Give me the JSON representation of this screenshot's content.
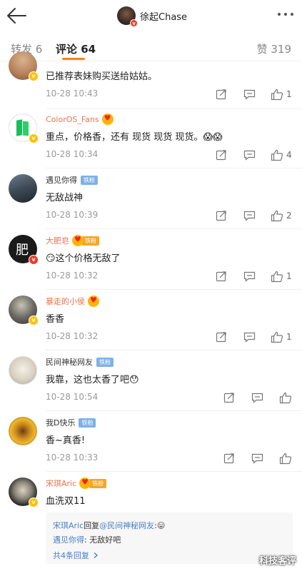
{
  "header": {
    "title": "徐起Chase",
    "back_icon": "back-arrow-icon",
    "more_icon": "more-dots-icon"
  },
  "tabs": {
    "repost": "转发 6",
    "comments": "评论 64",
    "likes": "赞 319",
    "accent": "#ff8200"
  },
  "comments": [
    {
      "user": "",
      "text": "已推荐表妹购买送给姑姑。",
      "time": "10-28 10:43",
      "likes": "1"
    },
    {
      "user": "ColorOS_Fans",
      "text": "重点，价格香，还有 现货 现货 现货。😱😱",
      "time": "10-28 10:34",
      "likes": "4"
    },
    {
      "user": "遇见你得",
      "badge": "铁粉",
      "text": "无敌战神",
      "time": "10-28 10:39",
      "likes": "2"
    },
    {
      "user": "大肥皂",
      "badge": "铁粉",
      "text": "😏这个价格无敌了",
      "time": "10-28 10:32",
      "likes": "1"
    },
    {
      "user": "暴走的小侯",
      "text": "香香",
      "time": "10-28 10:32",
      "likes": "1"
    },
    {
      "user": "民间神秘网友",
      "badge": "铁粉",
      "text": "我靠，这也太香了吧😯",
      "time": "10-28 10:54",
      "likes": ""
    },
    {
      "user": "我D快乐",
      "badge": "铁粉",
      "text": "香~真香!",
      "time": "10-28 10:33",
      "likes": ""
    },
    {
      "user": "宋琪Aric",
      "badge": "铁粉",
      "text": "血洗双11",
      "time": "",
      "likes": ""
    }
  ],
  "reply": {
    "line1_user": "宋琪Aric",
    "line1_mid": "回复",
    "line1_target": "@民间神秘网友",
    "line1_text": ":😛",
    "line2_user": "遇见你得",
    "line2_text": ": 无敌好吧",
    "more": "共4条回复"
  },
  "watermark": "科技客评",
  "colors": {
    "orange_name": "#eb7350",
    "link": "#4a7fc1",
    "fan_tag": "#7fb0e6"
  }
}
